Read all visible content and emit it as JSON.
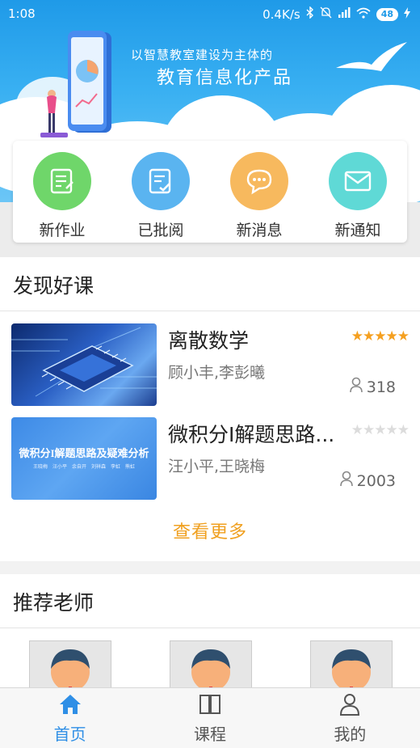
{
  "status_bar": {
    "time": "1:08",
    "speed": "0.4K/s",
    "battery": "48"
  },
  "banner": {
    "slogan_line1": "以智慧教室建设为主体的",
    "slogan_line2": "教育信息化产品"
  },
  "quick_actions": [
    {
      "label": "新作业",
      "icon": "edit-document-icon",
      "color": "#6fd66a"
    },
    {
      "label": "已批阅",
      "icon": "checklist-icon",
      "color": "#5ab4f0"
    },
    {
      "label": "新消息",
      "icon": "chat-bubble-icon",
      "color": "#f7b95e"
    },
    {
      "label": "新通知",
      "icon": "envelope-icon",
      "color": "#5fd9d6"
    }
  ],
  "discover": {
    "title": "发现好课",
    "courses": [
      {
        "title": "离散数学",
        "teachers": "顾小丰,李彭曦",
        "rating": 5,
        "count": "318"
      },
      {
        "title": "微积分I解题思路...",
        "teachers": "汪小平,王晓梅",
        "rating": 0,
        "count": "2003",
        "thumb_text": "微积分I解题思路及疑难分析",
        "thumb_subtext": "王晓梅　汪小平　余自开　刘祥森　李虹　熊虹"
      }
    ],
    "more_label": "查看更多"
  },
  "teachers_section": {
    "title": "推荐老师"
  },
  "tabs": [
    {
      "label": "首页",
      "icon": "home-icon",
      "active": true
    },
    {
      "label": "课程",
      "icon": "book-icon",
      "active": false
    },
    {
      "label": "我的",
      "icon": "user-icon",
      "active": false
    }
  ],
  "colors": {
    "brand_blue": "#1f9ae8",
    "accent_orange": "#f0a020",
    "star_filled": "#f5a020",
    "star_empty": "#dcdcdc"
  }
}
